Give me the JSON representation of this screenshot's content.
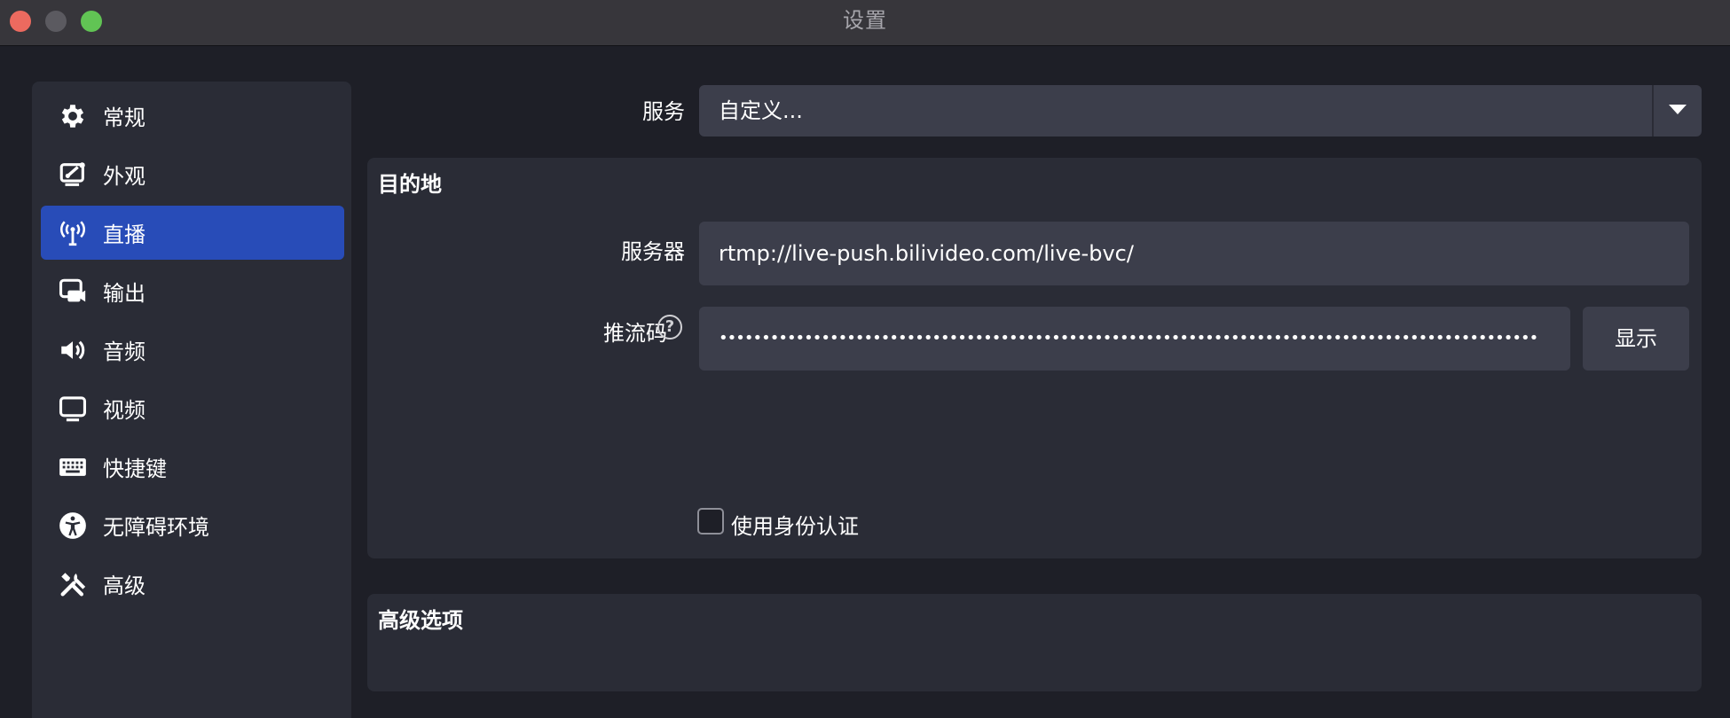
{
  "window": {
    "title": "设置"
  },
  "sidebar": {
    "items": [
      {
        "label": "常规",
        "icon": "gear-icon",
        "active": false
      },
      {
        "label": "外观",
        "icon": "appearance-icon",
        "active": false
      },
      {
        "label": "直播",
        "icon": "broadcast-icon",
        "active": true
      },
      {
        "label": "输出",
        "icon": "output-icon",
        "active": false
      },
      {
        "label": "音频",
        "icon": "speaker-icon",
        "active": false
      },
      {
        "label": "视频",
        "icon": "monitor-icon",
        "active": false
      },
      {
        "label": "快捷键",
        "icon": "keyboard-icon",
        "active": false
      },
      {
        "label": "无障碍环境",
        "icon": "accessibility-icon",
        "active": false
      },
      {
        "label": "高级",
        "icon": "tools-icon",
        "active": false
      }
    ]
  },
  "service": {
    "label": "服务",
    "value": "自定义..."
  },
  "destination": {
    "title": "目的地",
    "server_label": "服务器",
    "server_value": "rtmp://live-push.bilivideo.com/live-bvc/",
    "stream_key_label": "推流码",
    "stream_key_masked": "••••••••••••••••••••••••••••••••••••••••••••••••••••••••••••••••••••••••••••••••••••••••••••••••",
    "show_button": "显示",
    "auth_checkbox_label": "使用身份认证",
    "auth_checked": false
  },
  "advanced": {
    "title": "高级选项"
  },
  "colors": {
    "background": "#1e1f27",
    "panel": "#2a2c36",
    "field": "#3c3e4b",
    "accent": "#284cb8"
  }
}
